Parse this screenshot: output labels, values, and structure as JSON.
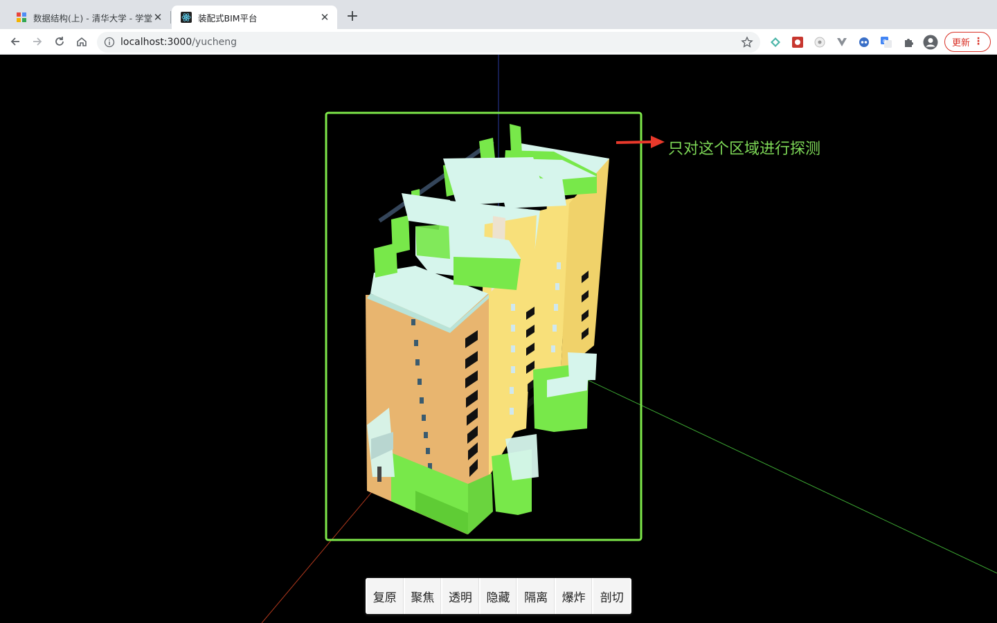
{
  "browser": {
    "tabs": [
      {
        "title": "数据结构(上) - 清华大学 - 学堂在",
        "active": false
      },
      {
        "title": "装配式BIM平台",
        "active": true
      }
    ],
    "url_host": "localhost:3000",
    "url_path": "/yucheng",
    "update_label": "更新"
  },
  "annotation": {
    "text": "只对这个区域进行探测",
    "color": "#7ed957",
    "arrow_color": "#e8392b"
  },
  "toolbar_buttons": [
    "复原",
    "聚焦",
    "透明",
    "隐藏",
    "隔离",
    "爆炸",
    "剖切"
  ],
  "colors": {
    "selection_box": "#7ee84a",
    "wall_tan": "#e8b56f",
    "wall_yellow": "#f8e07a",
    "roof_mint": "#d6f5ec",
    "base_green": "#78e84a"
  }
}
